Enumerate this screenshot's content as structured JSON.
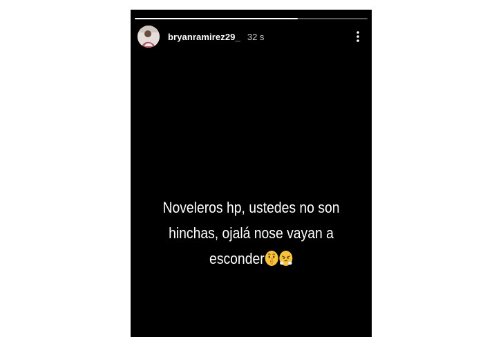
{
  "story": {
    "background": "#000000",
    "progress": 0.7,
    "user": {
      "username": "bryanramirez29_",
      "timestamp": "32 s"
    },
    "caption": {
      "lines": [
        "Noveleros hp, ustedes no son",
        "hinchas, ojalá nose vayan a",
        "esconder"
      ],
      "emojis": [
        "shushing-face-icon",
        "face-with-steam-icon"
      ]
    },
    "menu_icon": "more-vertical-icon"
  }
}
